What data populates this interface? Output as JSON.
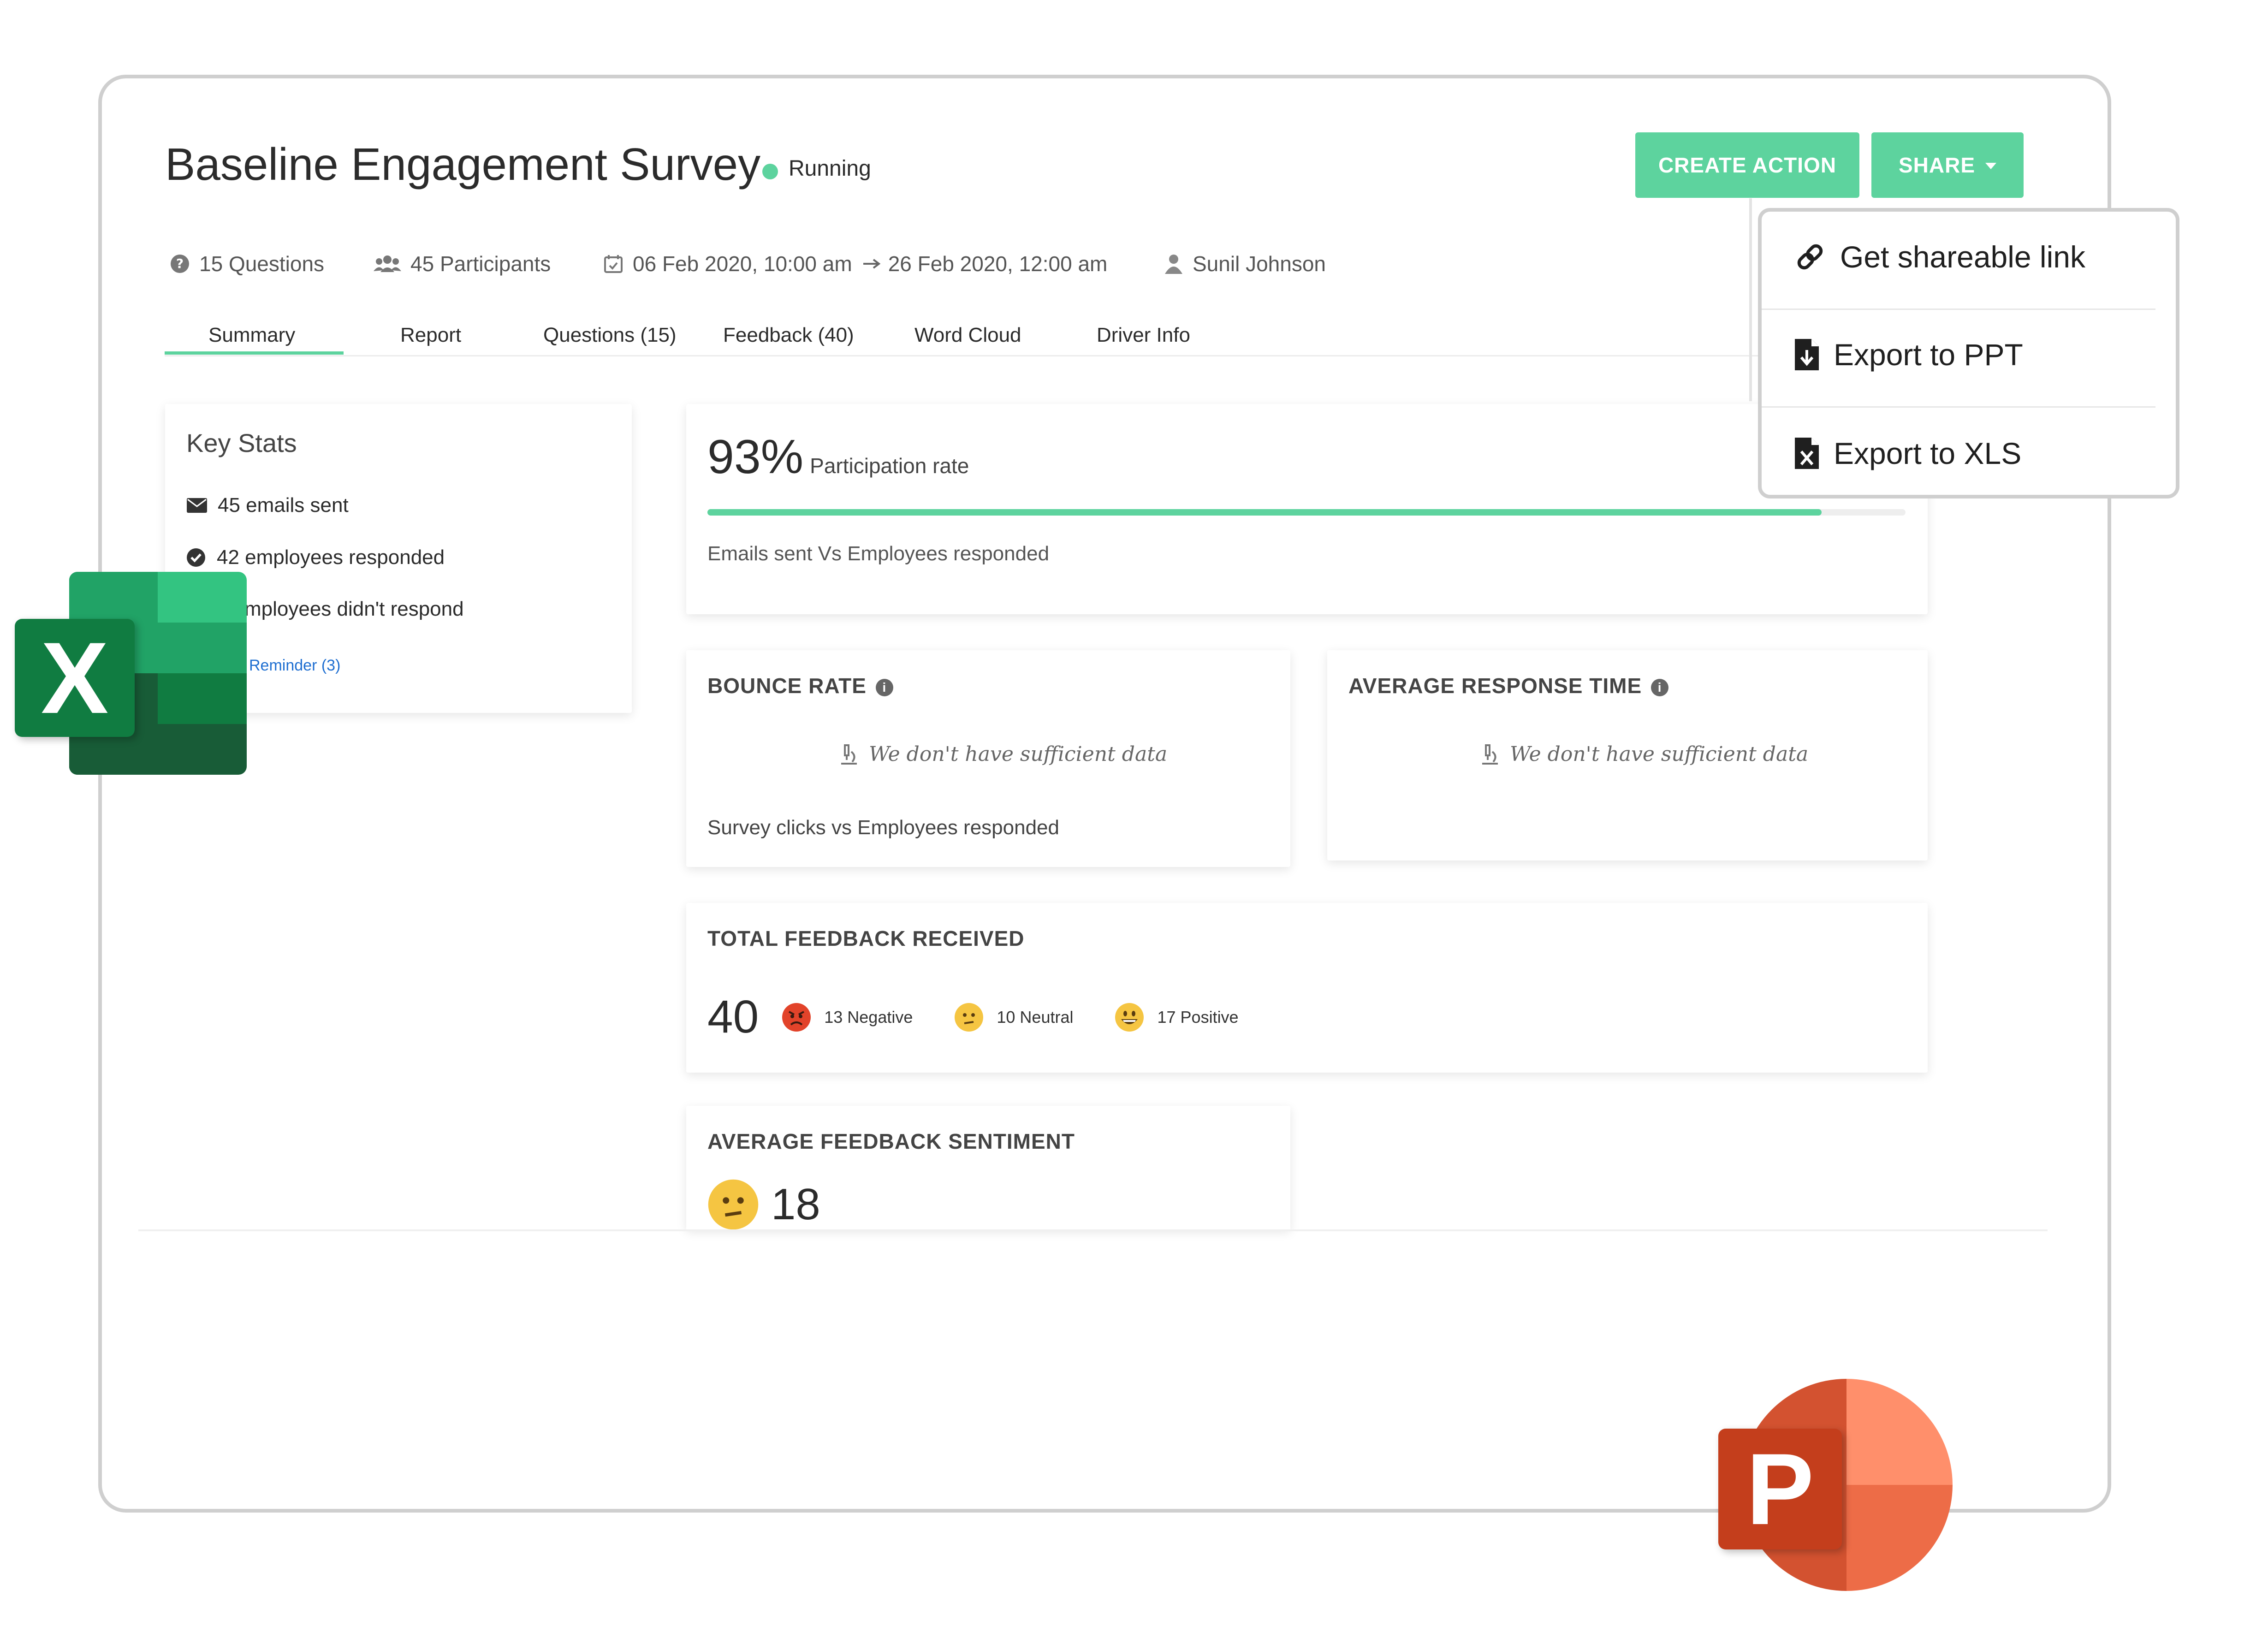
{
  "header": {
    "title": "Baseline Engagement Survey",
    "status": "Running",
    "status_color": "#5dd39e",
    "create_action_label": "CREATE ACTION",
    "share_label": "SHARE"
  },
  "meta": {
    "questions": "15 Questions",
    "participants": "45 Participants",
    "start_date": "06 Feb 2020, 10:00 am",
    "end_date": "26 Feb 2020, 12:00 am",
    "owner": "Sunil Johnson"
  },
  "tabs": [
    {
      "label": "Summary",
      "active": true
    },
    {
      "label": "Report"
    },
    {
      "label": "Questions (15)"
    },
    {
      "label": "Feedback (40)"
    },
    {
      "label": "Word Cloud"
    },
    {
      "label": "Driver Info"
    }
  ],
  "key_stats": {
    "title": "Key Stats",
    "emails_sent": "45 emails sent",
    "responded": "42 employees responded",
    "not_responded": "mployees didn't respond",
    "reminder_link": "Reminder (3)"
  },
  "participation": {
    "value": "93%",
    "label": "Participation rate",
    "progress": 0.93,
    "caption": "Emails sent Vs Employees responded"
  },
  "bounce_rate": {
    "title": "BOUNCE RATE",
    "no_data": "We don't have sufficient data",
    "caption": "Survey clicks vs Employees responded"
  },
  "avg_response_time": {
    "title": "AVERAGE RESPONSE TIME",
    "no_data": "We don't have sufficient data"
  },
  "total_feedback": {
    "title": "TOTAL FEEDBACK RECEIVED",
    "count": "40",
    "negative": "13 Negative",
    "neutral": "10 Neutral",
    "positive": "17 Positive"
  },
  "avg_sentiment": {
    "title": "AVERAGE FEEDBACK SENTIMENT",
    "value": "18"
  },
  "share_menu": {
    "items": [
      {
        "label": "Get shareable link",
        "icon": "link-icon"
      },
      {
        "label": "Export to PPT",
        "icon": "file-download-icon"
      },
      {
        "label": "Export to XLS",
        "icon": "file-excel-icon"
      }
    ]
  },
  "logos": {
    "excel_letter": "X",
    "powerpoint_letter": "P"
  },
  "colors": {
    "accent": "#5dd39e",
    "excel_green": "#1d7a45",
    "ppt_orange": "#d24726"
  }
}
